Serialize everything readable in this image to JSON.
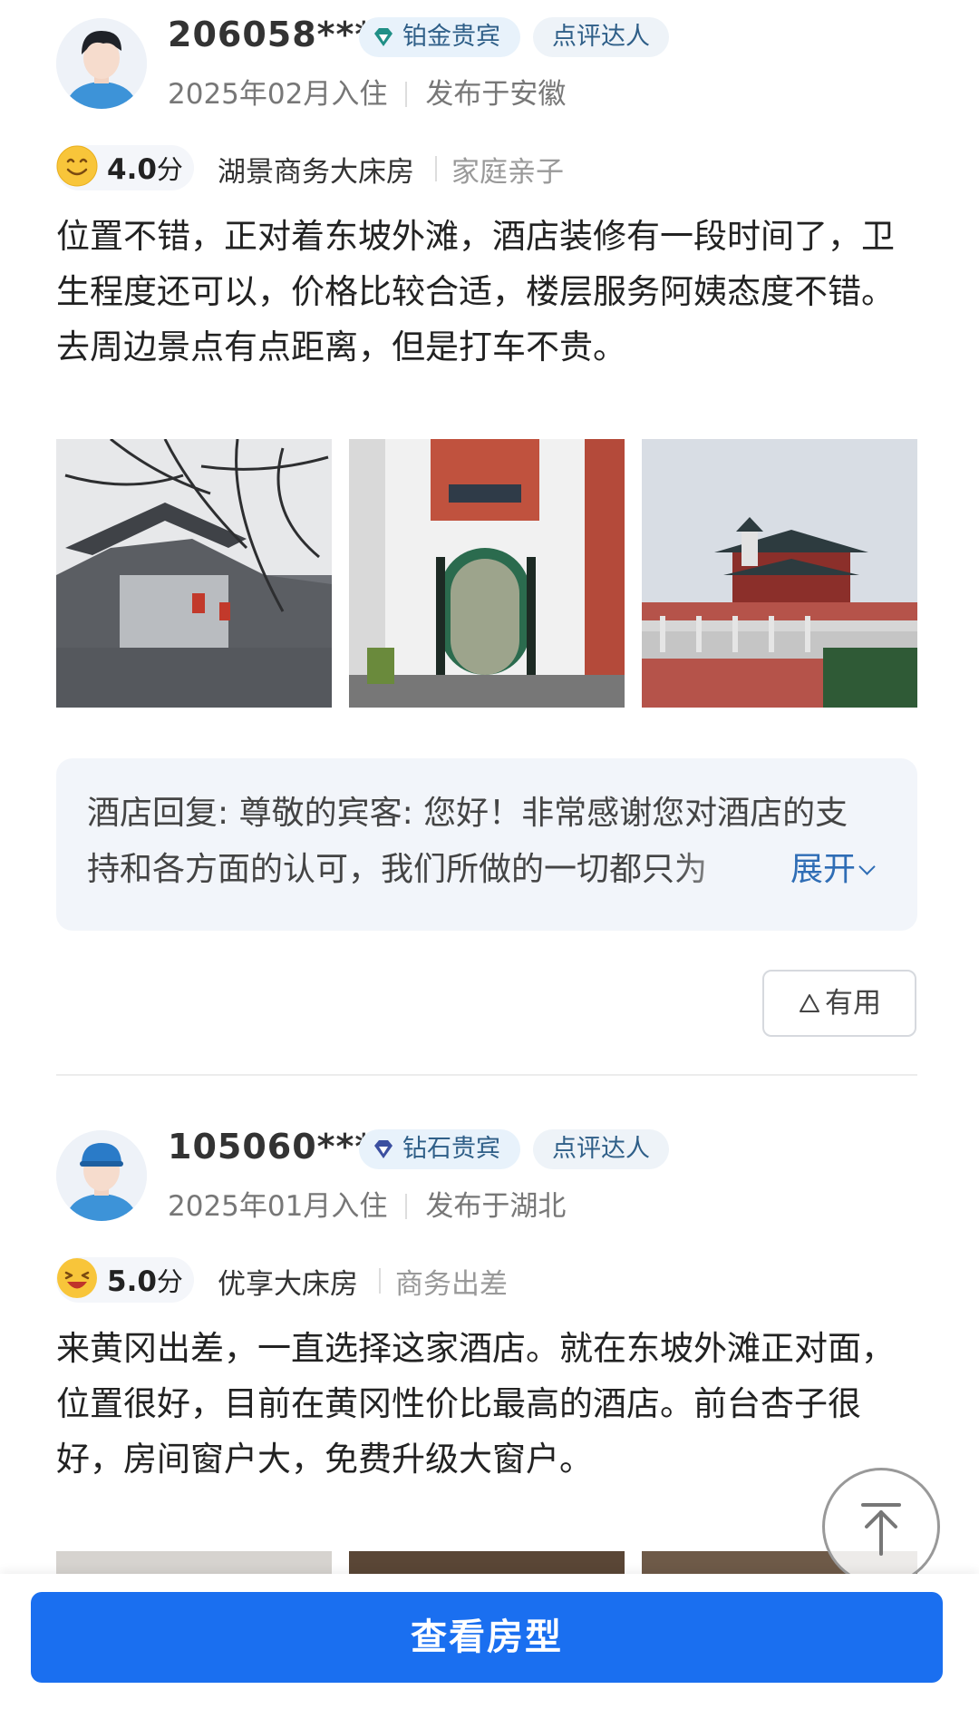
{
  "reviews": [
    {
      "user": "206058****",
      "member_level": "铂金贵宾",
      "critic_badge": "点评达人",
      "stay_date": "2025年02月入住",
      "posted_from": "发布于安徽",
      "score": "4.0",
      "score_unit": "分",
      "room_type": "湖景商务大床房",
      "trip_type": "家庭亲子",
      "content": "位置不错，正对着东坡外滩，酒店装修有一段时间了，卫生程度还可以，价格比较合适，楼层服务阿姨态度不错。去周边景点有点距离，但是打车不贵。",
      "hotel_reply": "酒店回复: 尊敬的宾客: 您好！非常感谢您对酒店的支持和各方面的认可，我们所做的一切都只为",
      "expand_label": "展开",
      "useful_label": "有用"
    },
    {
      "user": "105060****",
      "member_level": "钻石贵宾",
      "critic_badge": "点评达人",
      "stay_date": "2025年01月入住",
      "posted_from": "发布于湖北",
      "score": "5.0",
      "score_unit": "分",
      "room_type": "优享大床房",
      "trip_type": "商务出差",
      "content": "来黄冈出差，一直选择这家酒店。就在东坡外滩正对面，位置很好，目前在黄冈性价比最高的酒店。前台杏子很好，房间窗户大，免费升级大窗户。"
    }
  ],
  "cta_label": "查看房型",
  "colors": {
    "accent": "#1a6ff0",
    "link": "#2f6db5",
    "badge_bg": "#e8f2fb"
  },
  "icons": [
    "avatar-icon",
    "diamond-icon",
    "smile-emoji-icon",
    "laugh-emoji-icon",
    "chevron-down-icon",
    "thumb-up-icon",
    "back-to-top-icon"
  ]
}
